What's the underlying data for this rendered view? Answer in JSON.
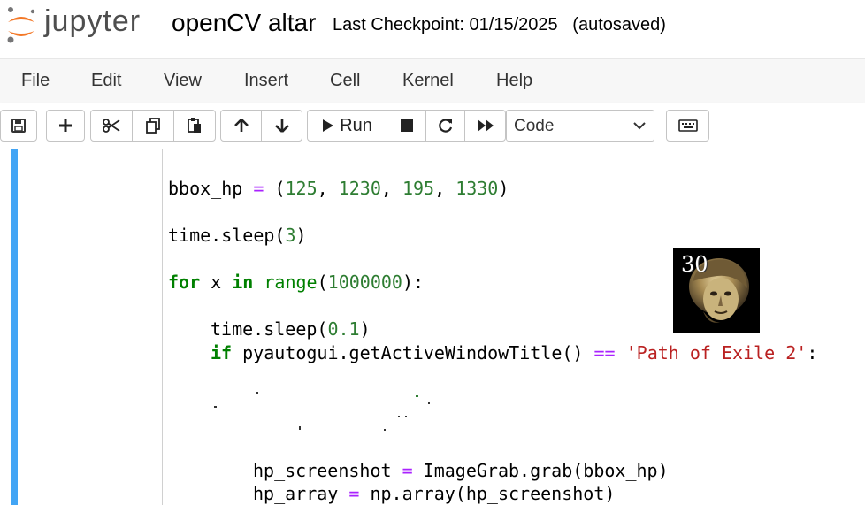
{
  "header": {
    "logo_text": "jupyter",
    "notebook_title": "openCV altar",
    "checkpoint": "Last Checkpoint: 01/15/2025   (autosaved)"
  },
  "menu": {
    "items": [
      "File",
      "Edit",
      "View",
      "Insert",
      "Cell",
      "Kernel",
      "Help"
    ]
  },
  "toolbar": {
    "run_label": "Run",
    "cell_type": "Code"
  },
  "code": {
    "line1": {
      "name": "bbox_hp",
      "op": "=",
      "open": "(",
      "n1": "125",
      "n2": "1230",
      "n3": "195",
      "n4": "1330",
      "close": ")"
    },
    "line2": {
      "prefix": "time.sleep(",
      "arg": "3",
      "suffix": ")"
    },
    "line3": {
      "kw_for": "for",
      "var": " x ",
      "kw_in": "in",
      "fn": "range",
      "open": "(",
      "arg": "1000000",
      "close": "):"
    },
    "line4": {
      "prefix": "time.sleep(",
      "arg": "0.1",
      "suffix": ")"
    },
    "line5": {
      "kw_if": "if",
      "call": " pyautogui.getActiveWindowTitle() ",
      "op": "==",
      "str": "'Path of Exile 2'",
      "end": ":"
    },
    "line6": {
      "name": "hp_screenshot",
      "op": "=",
      "rest": " ImageGrab.grab(bbox_hp)"
    },
    "line7": {
      "name": "hp_array",
      "op": "=",
      "rest": " np.array(hp_screenshot)"
    }
  },
  "output_image": {
    "count": "30",
    "subject": "ancient-orb-face-icon"
  },
  "colors": {
    "cell_border": "#42a5f5",
    "jupyter_orange": "#f37726",
    "keyword_green": "#008000",
    "number_green": "#2e7d32",
    "operator_purple": "#aa22ff",
    "string_red": "#ba2121"
  }
}
